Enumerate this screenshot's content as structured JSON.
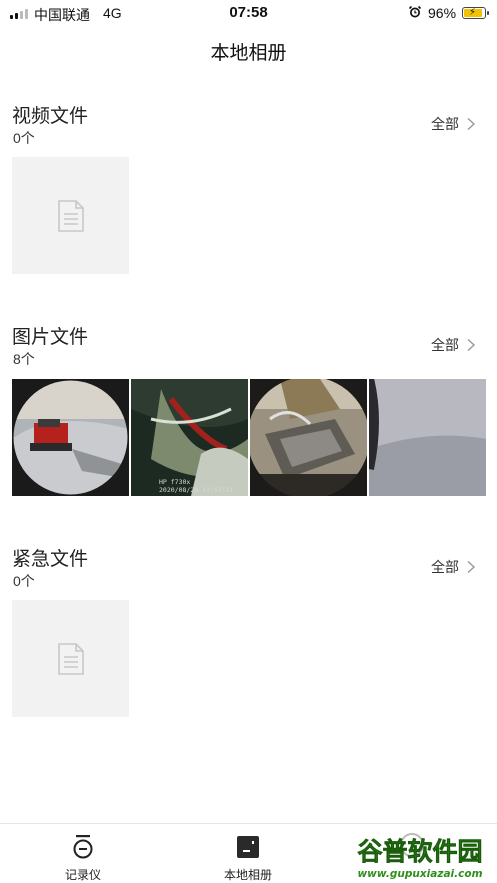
{
  "status": {
    "carrier": "中国联通",
    "network": "4G",
    "time": "07:58",
    "battery_percent": "96%",
    "battery_level": 0.96,
    "icons": [
      "signal-icon",
      "alarm-icon",
      "battery-charging-icon"
    ]
  },
  "header": {
    "title": "本地相册"
  },
  "sections": [
    {
      "title": "视频文件",
      "count": "0个",
      "all_label": "全部"
    },
    {
      "title": "图片文件",
      "count": "8个",
      "all_label": "全部"
    },
    {
      "title": "紧急文件",
      "count": "0个",
      "all_label": "全部"
    }
  ],
  "photos": [
    {
      "stamp": ""
    },
    {
      "stamp": "HP f730x\n2020/08/29 11:57:11"
    },
    {
      "stamp": ""
    },
    {
      "stamp": ""
    }
  ],
  "tabs": [
    {
      "label": "记录仪",
      "icon": "dashcam-icon"
    },
    {
      "label": "本地相册",
      "icon": "album-icon"
    }
  ],
  "watermark": {
    "title": "谷普软件园",
    "url": "www.gupuxiazai.com"
  },
  "colors": {
    "placeholder_bg": "#f2f2f2",
    "battery": "#f2c200",
    "text": "#222222"
  }
}
